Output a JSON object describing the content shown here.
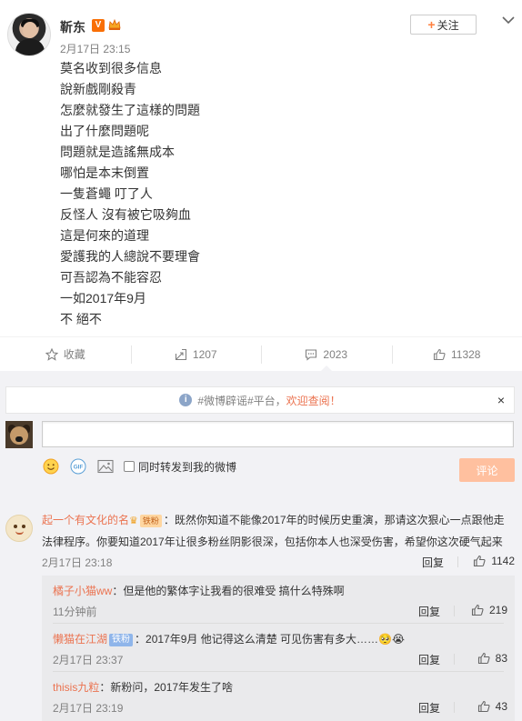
{
  "post": {
    "username": "靳东",
    "vbadge": "V",
    "time": "2月17日 23:15",
    "follow_label": "关注",
    "lines": [
      "莫名收到很多信息",
      "說新戲剛殺青",
      "怎麼就發生了這樣的問題",
      "出了什麼問題呢",
      "問題就是造謠無成本",
      "哪怕是本末倒置",
      "一隻蒼蠅 叮了人",
      "反怪人 沒有被它吸夠血",
      "這是何來的道理",
      "愛護我的人總說不要理會",
      "可吾認為不能容忍",
      "一如2017年9月",
      "不 絕不"
    ]
  },
  "actions": {
    "favorite": "收藏",
    "forward": "1207",
    "comment": "2023",
    "like": "11328"
  },
  "notice": {
    "prefix": "#微博辟谣#平台，",
    "link": "欢迎查阅！",
    "close": "×"
  },
  "compose": {
    "forward_label": "同时转发到我的微博",
    "submit_label": "评论"
  },
  "comments": [
    {
      "name": "起一个有文化的名",
      "badge": "铁粉",
      "text": "：既然你知道不能像2017年的时候历史重演，那请这次狠心一点跟他走法律程序。你要知道2017年让很多粉丝阴影很深，包括你本人也深受伤害，希望你这次硬气起来",
      "time": "2月17日 23:18",
      "reply": "回复",
      "likes": "1142",
      "replies": [
        {
          "name": "橘子小猫ww",
          "text": "：但是他的繁体字让我看的很难受 搞什么特殊啊",
          "time": "11分钟前",
          "reply": "回复",
          "likes": "219"
        },
        {
          "name": "懒猫在江湖",
          "badge": "铁粉",
          "text": "：2017年9月 他记得这么清楚 可见伤害有多大……🥺😭",
          "time": "2月17日 23:37",
          "reply": "回复",
          "likes": "83"
        },
        {
          "name": "thisis九粒",
          "text": "：新粉问，2017年发生了啥",
          "time": "2月17日 23:19",
          "reply": "回复",
          "likes": "43"
        }
      ]
    }
  ],
  "colors": {
    "accent": "#eb7350",
    "submit_bg": "#ffc09f",
    "bg_gray": "#f2f2f5"
  }
}
